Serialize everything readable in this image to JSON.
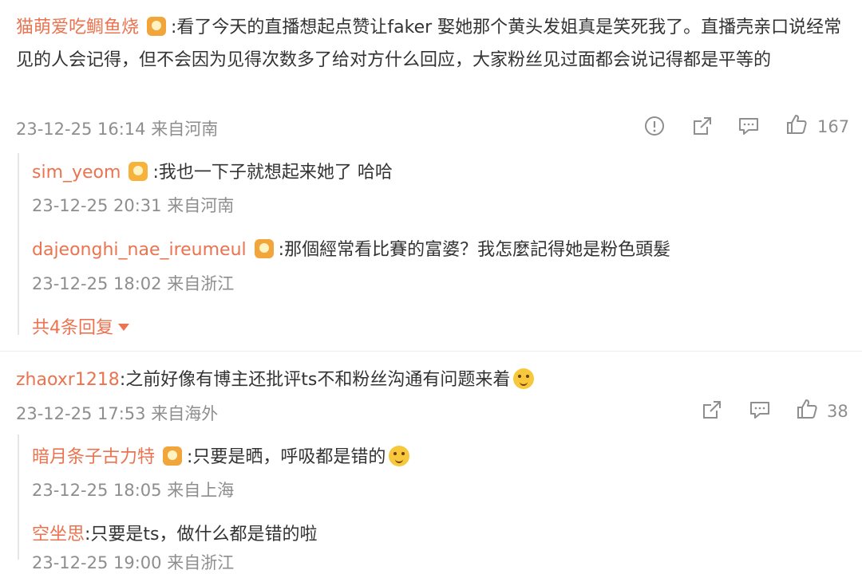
{
  "comments": [
    {
      "user": "猫萌爱吃鲷鱼烧",
      "text": ":看了今天的直播想起点赞让faker 娶她那个黄头发姐真是笑死我了。直播壳亲口说经常见的人会记得，但不会因为见得次数多了给对方什么回应，大家粉丝见过面都会说记得都是平等的",
      "meta": "23-12-25 16:14 来自河南",
      "likes": "167",
      "replies": [
        {
          "user": "sim_yeom",
          "text": ":我也一下子就想起来她了 哈哈",
          "meta": "23-12-25 20:31 来自河南"
        },
        {
          "user": "dajeonghi_nae_ireumeul",
          "text": ":那個經常看比賽的富婆？我怎麼記得她是粉色頭髮",
          "meta": "23-12-25 18:02 来自浙江"
        }
      ],
      "more_replies": "共4条回复"
    },
    {
      "user": "zhaoxr1218",
      "text": ":之前好像有博主还批评ts不和粉丝沟通有问题来着",
      "meta": "23-12-25 17:53 来自海外",
      "likes": "38",
      "replies": [
        {
          "user": "暗月条子古力特",
          "text": ":只要是晒，呼吸都是错的",
          "meta": "23-12-25 18:05 来自上海"
        },
        {
          "user": "空坐思",
          "text": ":只要是ts，做什么都是错的啦",
          "meta": "23-12-25 19:00 来自浙江"
        }
      ]
    }
  ],
  "icons": {
    "report": "report-icon",
    "share": "share-icon",
    "comment": "comment-icon",
    "like": "like-icon",
    "badge": "fan-badge-icon",
    "emoji": "doge-emoji-icon",
    "expand": "caret-down-icon"
  },
  "colors": {
    "username": "#eb7350",
    "text": "#333333",
    "meta": "#8e8e8e"
  }
}
